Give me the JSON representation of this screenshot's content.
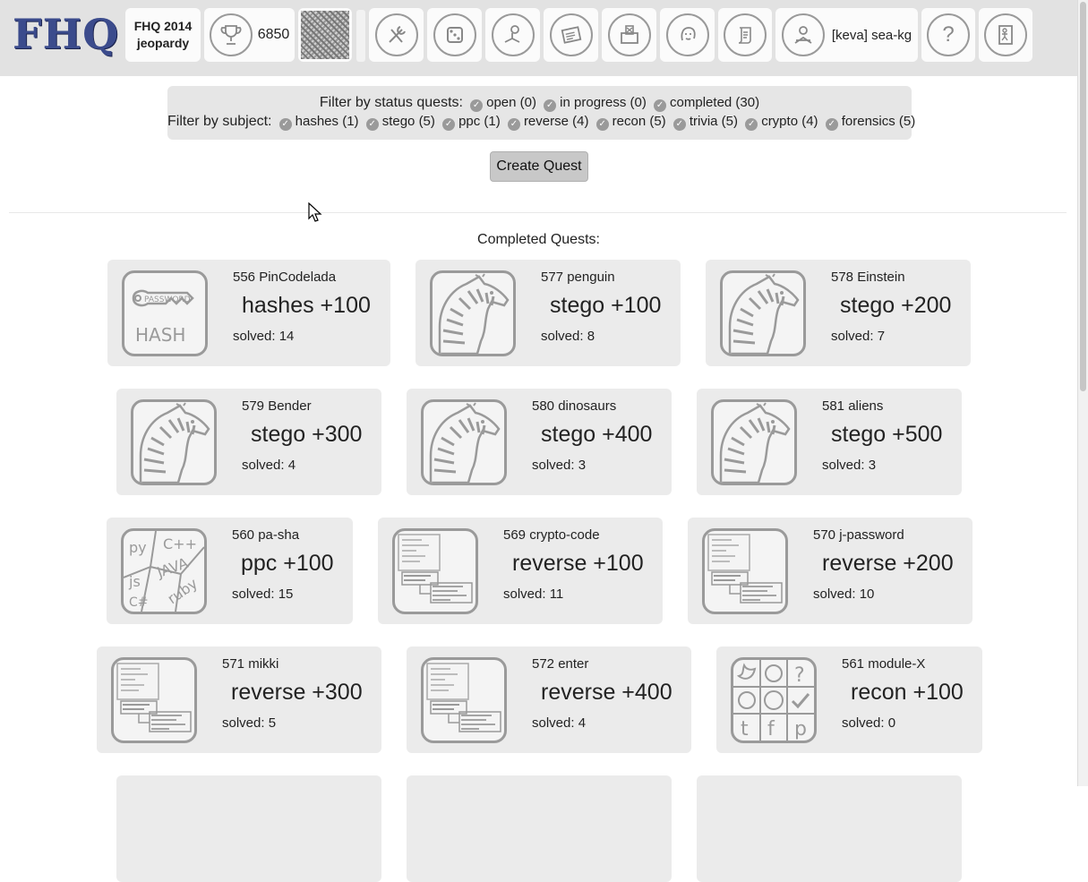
{
  "header": {
    "logo_text": "FHQ",
    "game_title_line1": "FHQ 2014",
    "game_title_line2": "jeopardy",
    "score": "6850",
    "user_name": "[keva] sea-kg",
    "nav_icons": [
      "tools-icon",
      "dice-icon",
      "reading-icon",
      "news-icon",
      "ballot-box-icon",
      "avatar-face-icon",
      "scroll-icon"
    ]
  },
  "filters": {
    "status_label": "Filter by status quests:",
    "status_items": [
      "open (0)",
      "in progress (0)",
      "completed (30)"
    ],
    "subject_label": "Filter by subject:",
    "subject_items": [
      "hashes (1)",
      "stego (5)",
      "ppc (1)",
      "reverse (4)",
      "recon (5)",
      "trivia (5)",
      "crypto (4)",
      "forensics (5)"
    ]
  },
  "create_quest_label": "Create Quest",
  "section_title": "Completed Quests:",
  "quests": [
    {
      "name": "556 PinCodelada",
      "score": "hashes +100",
      "solved": "solved: 14",
      "icon": "hash-key-icon"
    },
    {
      "name": "577 penguin",
      "score": "stego +100",
      "solved": "solved: 8",
      "icon": "zebra-icon"
    },
    {
      "name": "578 Einstein",
      "score": "stego +200",
      "solved": "solved: 7",
      "icon": "zebra-icon"
    },
    {
      "name": "579 Bender",
      "score": "stego +300",
      "solved": "solved: 4",
      "icon": "zebra-icon"
    },
    {
      "name": "580 dinosaurs",
      "score": "stego +400",
      "solved": "solved: 3",
      "icon": "zebra-icon"
    },
    {
      "name": "581 aliens",
      "score": "stego +500",
      "solved": "solved: 3",
      "icon": "zebra-icon"
    },
    {
      "name": "560 pa-sha",
      "score": "ppc +100",
      "solved": "solved: 15",
      "icon": "programming-languages-icon"
    },
    {
      "name": "569 crypto-code",
      "score": "reverse +100",
      "solved": "solved: 11",
      "icon": "disassembler-icon"
    },
    {
      "name": "570 j-password",
      "score": "reverse +200",
      "solved": "solved: 10",
      "icon": "disassembler-icon"
    },
    {
      "name": "571 mikki",
      "score": "reverse +300",
      "solved": "solved: 5",
      "icon": "disassembler-icon"
    },
    {
      "name": "572 enter",
      "score": "reverse +400",
      "solved": "solved: 4",
      "icon": "disassembler-icon"
    },
    {
      "name": "561 module-X",
      "score": "recon +100",
      "solved": "solved: 0",
      "icon": "social-networks-icon"
    }
  ],
  "hash_icon_text": {
    "top": "PASSWORD",
    "bottom": "HASH"
  },
  "ppc_icon_text": [
    "py",
    "C++",
    "js",
    "JAVA",
    "C#",
    "ruby"
  ],
  "recon_icon_glyphs": [
    "?",
    "t",
    "f",
    "p"
  ],
  "help_glyph": "?"
}
